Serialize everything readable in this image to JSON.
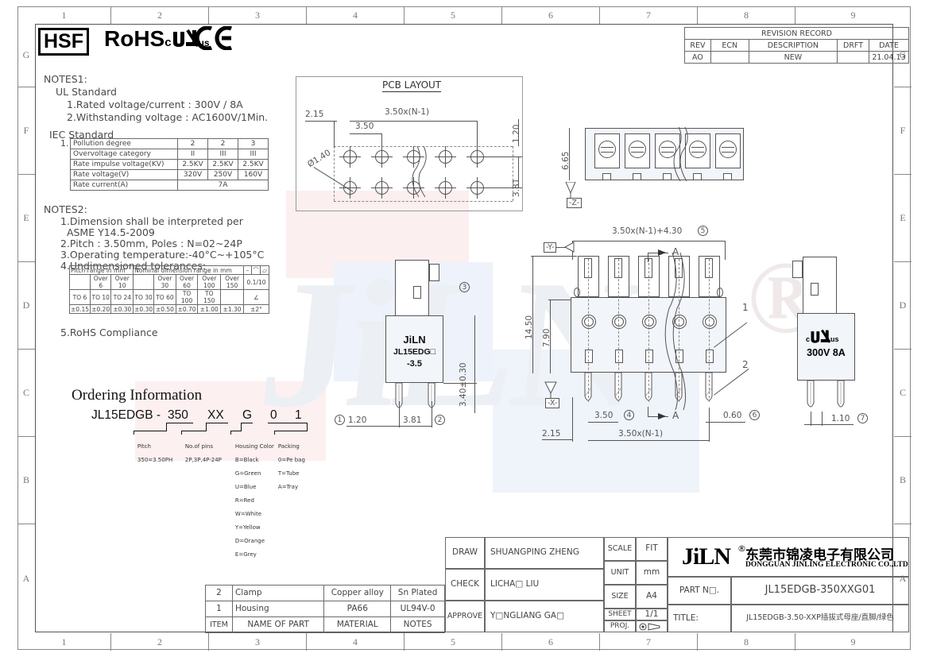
{
  "frame": {
    "top_zones": [
      "1",
      "2",
      "3",
      "4",
      "5",
      "6",
      "7",
      "8",
      "9"
    ],
    "bottom_zones": [
      "1",
      "2",
      "3",
      "4",
      "5",
      "6",
      "7",
      "8",
      "9"
    ],
    "row_zones": [
      "G",
      "F",
      "E",
      "D",
      "C",
      "B",
      "A"
    ]
  },
  "marks": {
    "hsf": "HSF",
    "rohs": "RoHS",
    "ul_c": "c",
    "ul_us": "us",
    "ce": "CE"
  },
  "notes1": {
    "heading": "NOTES1:",
    "ul_heading": "UL Standard",
    "ul_items": [
      "1.Rated voltage/current : 300V / 8A",
      "2.Withstanding voltage : AC1600V/1Min."
    ],
    "iec_heading": "IEC Standard",
    "iec_index": "1."
  },
  "iec_table": {
    "rows": [
      {
        "label": "Pollution degree",
        "cells": [
          "2",
          "2",
          "3"
        ]
      },
      {
        "label": "Overvoltage category",
        "cells": [
          "II",
          "III",
          "III"
        ]
      },
      {
        "label": "Rate impulse voltage(KV)",
        "cells": [
          "2.5KV",
          "2.5KV",
          "2.5KV"
        ]
      },
      {
        "label": "Rate voltage(V)",
        "cells": [
          "320V",
          "250V",
          "160V"
        ]
      }
    ],
    "last_row_label": "Rate current(A)",
    "last_row_value": "7A"
  },
  "notes2": {
    "heading": "NOTES2:",
    "items": [
      "1.Dimension shall be interpreted per",
      "  ASME Y14.5-2009",
      "2.Pitch : 3.50mm, Poles : N=02~24P",
      "3.Operating temperature:-40°C~+105°C",
      "4.Undimensioned tolerances:"
    ],
    "item5": "5.RoHS Compliance"
  },
  "tolerance_table": {
    "header_left": "Pitch range in mm",
    "header_mid": "Nominal dimension range in mm",
    "header_sym1": "–",
    "header_sym2": "⌒",
    "header_sym3": "▱",
    "sub": [
      "",
      "Over 6",
      "Over 10",
      "",
      "Over 30",
      "Over 60",
      "Over 100",
      "Over 150"
    ],
    "sub2": [
      "TO 6",
      "TO 10",
      "TO 24",
      "TO 30",
      "TO 60",
      "TO 100",
      "TO 150",
      ""
    ],
    "values": [
      "±0.15",
      "±0.20",
      "±0.30",
      "±0.30",
      "±0.50",
      "±0.70",
      "±1.00",
      "±1.30"
    ],
    "right_top": "0.1/10",
    "right_mid": "∠",
    "right_val": "±2°"
  },
  "ordering": {
    "title": "Ordering Information",
    "segments": [
      {
        "text": "JL15EDGB - ",
        "underline": false
      },
      {
        "text": "350",
        "underline": true
      },
      {
        "text": "XX",
        "underline": true
      },
      {
        "text": "G",
        "underline": true
      },
      {
        "text": "0",
        "underline": true
      },
      {
        "text": "1",
        "underline": true
      }
    ],
    "legends": [
      {
        "title": "Pitch",
        "lines": [
          "350=3.50PH"
        ]
      },
      {
        "title": "No.of pins",
        "lines": [
          "2P,3P,4P-24P"
        ]
      },
      {
        "title": "Housing Color",
        "lines": [
          "B=Black",
          "G=Green",
          "U=Blue",
          "R=Red",
          "W=White",
          "Y=Yellow",
          "D=Orange",
          "E=Grey"
        ]
      },
      {
        "title": "Packing",
        "lines": [
          "0=Pe bag",
          "T=Tube",
          "A=Tray"
        ]
      }
    ]
  },
  "pcb_layout": {
    "title": "PCB LAYOUT",
    "dim_2_15": "2.15",
    "dim_3_50": "3.50",
    "dim_pitch_n": "3.50x(N-1)",
    "dim_1_20": "1.20",
    "dim_3_81": "3.81",
    "dim_hole": "Ø1.40"
  },
  "front_view": {
    "dim_6_65": "6.65",
    "datum_z": "-Z-"
  },
  "part_detail": {
    "brand": "JiLN",
    "model": "JL15EDG□",
    "pitch": "-3.5",
    "dim_1_20": "1.20",
    "dim_3_81": "3.81",
    "dim_3_40": "3.40±0.30",
    "bubble_1": "1",
    "bubble_2": "2",
    "bubble_3": "3"
  },
  "main_view": {
    "dim_top": "3.50x(N-1)+4.30",
    "bubble_top": "5",
    "dim_14_50": "14.50",
    "dim_7_90": "7.90",
    "dim_3_50": "3.50",
    "bubble_3_50": "4",
    "dim_0_60": "0.60",
    "bubble_0_60": "6",
    "dim_2_15": "2.15",
    "dim_bottom": "3.50x(N-1)",
    "datum_x": "-X-",
    "datum_y": "-Y-",
    "section_a1": "A",
    "section_a2": "A",
    "item_1": "1",
    "item_2": "2"
  },
  "ul_detail": {
    "ul_c": "c",
    "ul_us": "us",
    "rating": "300V  8A",
    "dim_1_10": "1.10",
    "bubble_7": "7"
  },
  "revision": {
    "title": "REVISION RECORD",
    "headers": [
      "REV",
      "ECN",
      "DESCRIPTION",
      "DRFT",
      "DATE"
    ],
    "rows": [
      {
        "rev": "AO",
        "ecn": "",
        "description": "NEW",
        "drft": "",
        "date": "21.04.13"
      }
    ]
  },
  "bom": {
    "headers": [
      "ITEM",
      "NAME OF PART",
      "MATERIAL",
      "NOTES"
    ],
    "rows": [
      {
        "item": "2",
        "name": "Clamp",
        "material": "Copper alloy",
        "notes": "Sn Plated"
      },
      {
        "item": "1",
        "name": "Housing",
        "material": "PA66",
        "notes": "UL94V-0"
      }
    ]
  },
  "title_block": {
    "draw_label": "DRAW",
    "draw_value": "SHUANGPING ZHENG",
    "check_label": "CHECK",
    "check_value": "LICHA□  LIU",
    "approve_label": "APPROVE",
    "approve_value": "Y□NGLIANG GA□",
    "scale_label": "SCALE",
    "scale_value": "FIT",
    "unit_label": "UNIT",
    "unit_value": "mm",
    "size_label": "SIZE",
    "size_value": "A4",
    "sheet_label": "SHEET",
    "sheet_value": "1/1",
    "proj_label": "PROJ.",
    "company_logo": "JiLN",
    "company_reg": "®",
    "company_cn": "东莞市锦凌电子有限公司",
    "company_en": "DONGGUAN JINLING ELECTRONIC CO.,LTD",
    "partno_label": "PART N□.",
    "partno_value": "JL15EDGB-350XXG01",
    "title_label": "TITLE:",
    "title_value": "JL15EDGB-3.50-XXP插拔式母座/直脚/绿色"
  }
}
